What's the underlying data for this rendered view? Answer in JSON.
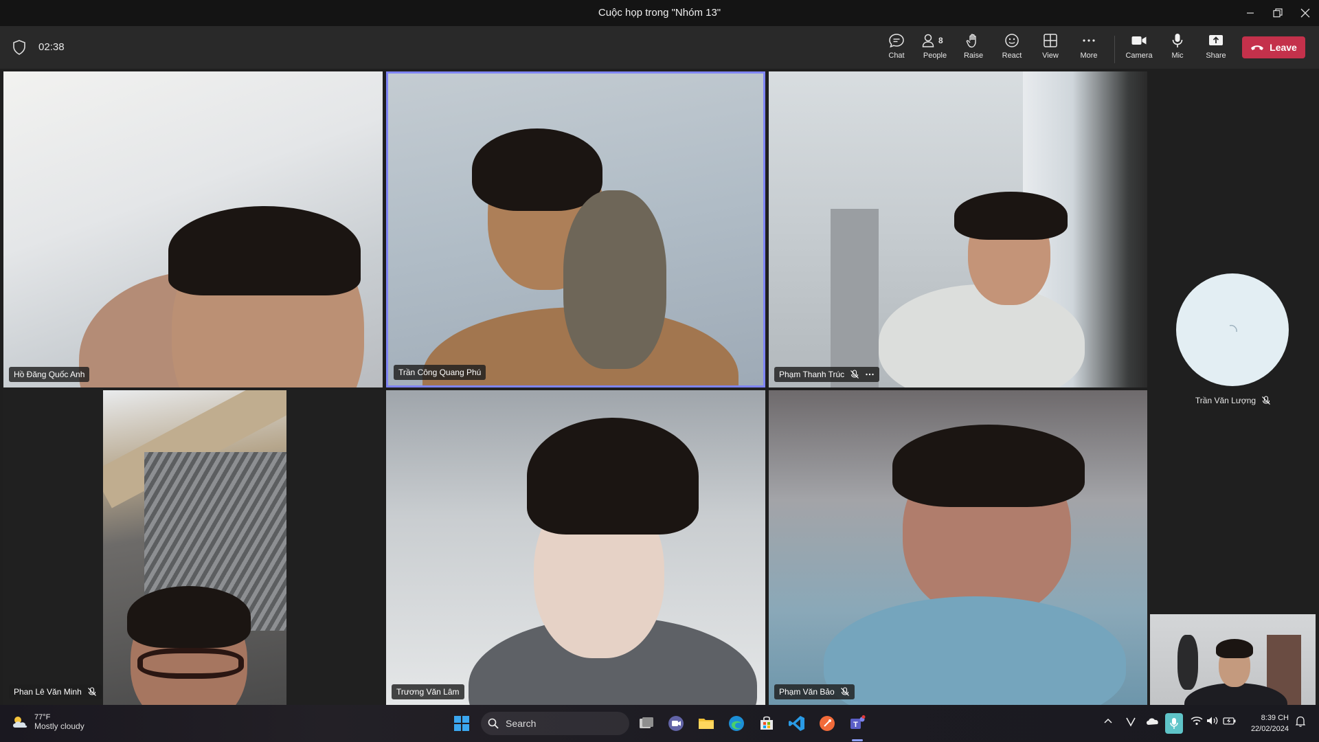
{
  "window": {
    "title": "Cuộc họp trong \"Nhóm 13\"",
    "controls": [
      "minimize",
      "restore",
      "close"
    ]
  },
  "toolbar": {
    "timer": "02:38",
    "chat_label": "Chat",
    "people_label": "People",
    "people_count": "8",
    "raise_label": "Raise",
    "react_label": "React",
    "view_label": "View",
    "more_label": "More",
    "camera_label": "Camera",
    "mic_label": "Mic",
    "share_label": "Share",
    "leave_label": "Leave",
    "leave_color": "#c4314b"
  },
  "participants": [
    {
      "name": "Hồ Đăng Quốc Anh",
      "muted": false
    },
    {
      "name": "Trần Công Quang Phú",
      "muted": false,
      "active_speaker": true
    },
    {
      "name": "Phạm Thanh Trúc",
      "muted": true,
      "has_more": true
    },
    {
      "name": "Phan Lê Văn Minh",
      "muted": true
    },
    {
      "name": "Trương Văn Lâm",
      "muted": false
    },
    {
      "name": "Phạm Văn Bảo",
      "muted": true
    }
  ],
  "side_participant": {
    "name": "Trần Văn Lượng",
    "muted": true
  },
  "highlight_color": "#7f85f5",
  "taskbar": {
    "weather_temp": "77°F",
    "weather_cond": "Mostly cloudy",
    "search_label": "Search",
    "clock_time": "8:39 CH",
    "clock_date": "22/02/2024",
    "apps": [
      "start-icon",
      "task-view-icon",
      "meet-icon",
      "file-explorer-icon",
      "edge-icon",
      "store-icon",
      "vscode-icon",
      "postman-icon",
      "teams-icon"
    ]
  }
}
